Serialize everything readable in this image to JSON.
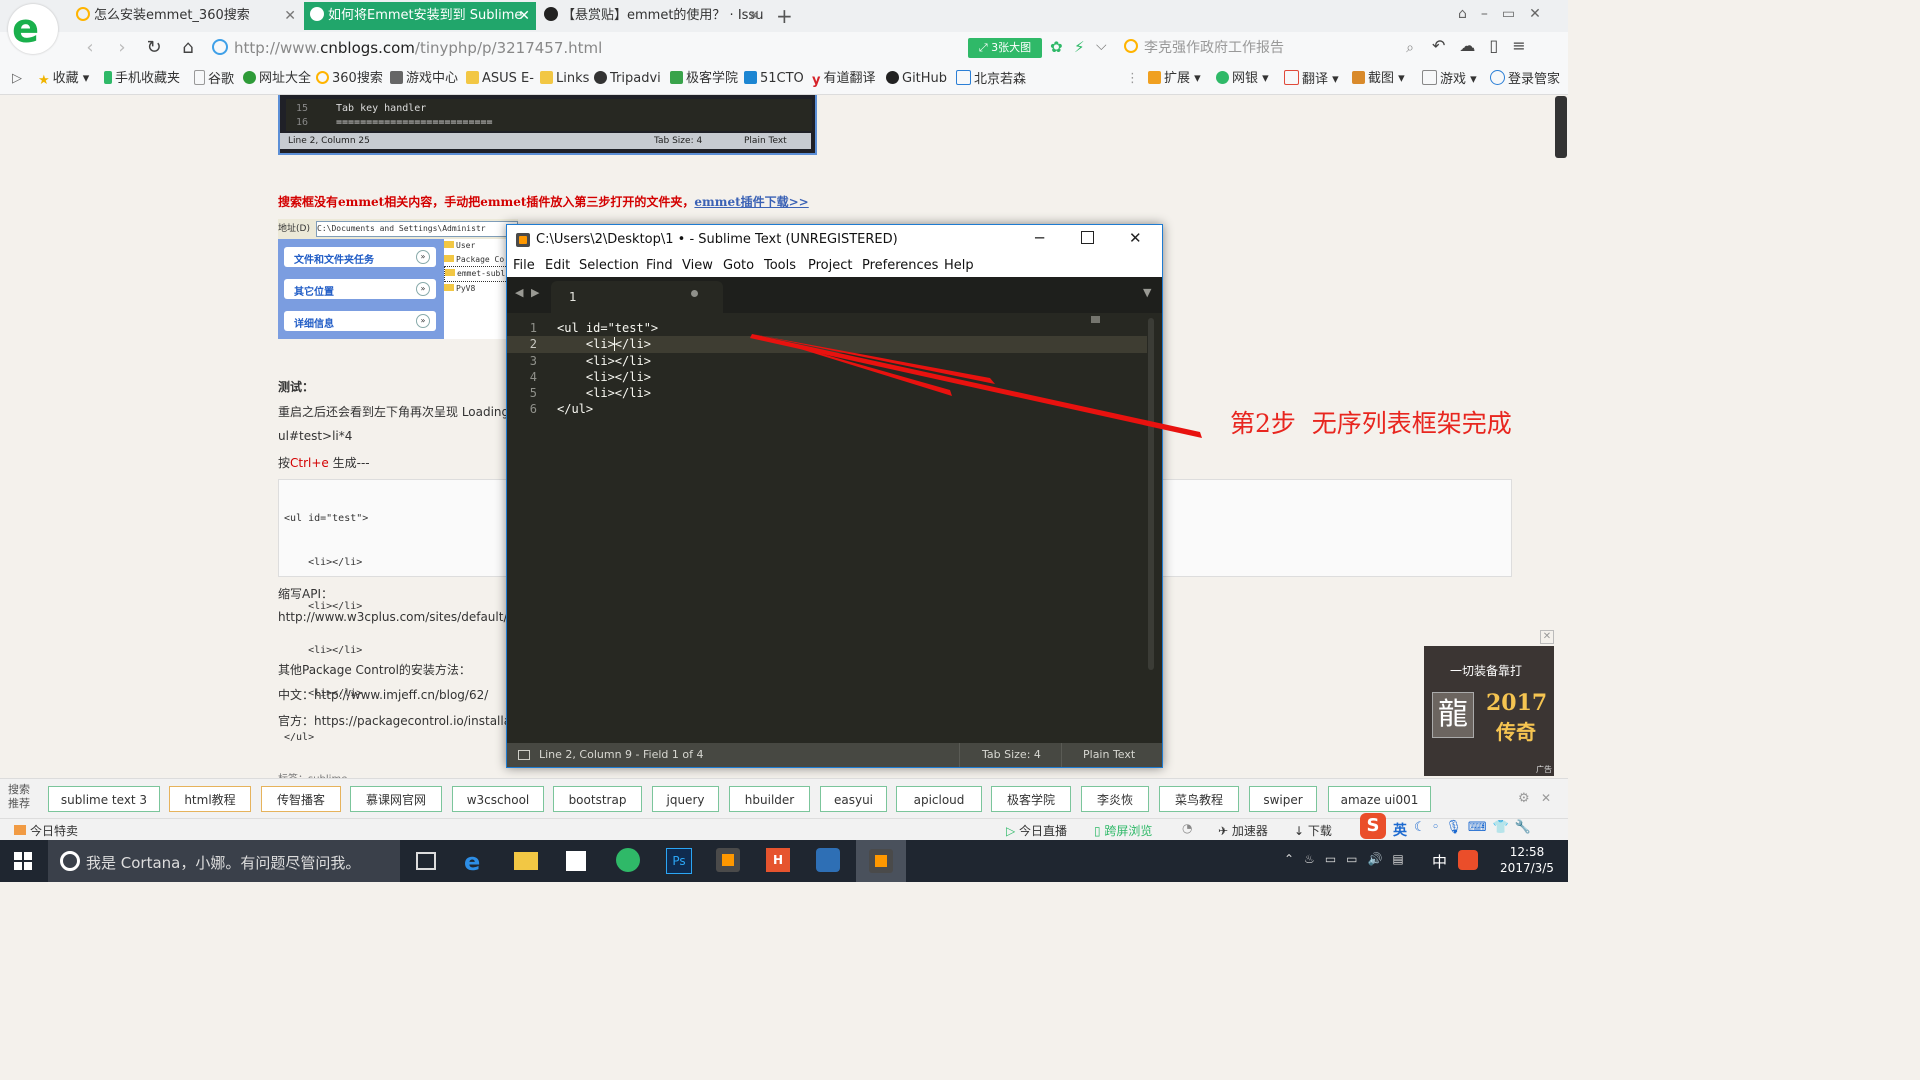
{
  "browser": {
    "tabs": [
      {
        "label": "怎么安装emmet_360搜索",
        "active": false
      },
      {
        "label": "如何将Emmet安装到到 Sublime",
        "active": true
      },
      {
        "label": "【悬赏贴】emmet的使用？ · Issu",
        "active": false
      }
    ],
    "url_prefix": "http://www.",
    "url_host": "cnblogs.com",
    "url_path": "/tinyphp/p/3217457.html",
    "big_pic_label": "3张大图",
    "search_hint": "李克强作政府工作报告",
    "bookmarks": [
      "收藏",
      "手机收藏夹",
      "谷歌",
      "网址大全",
      "360搜索",
      "游戏中心",
      "ASUS E-",
      "Links",
      "Tripadvi",
      "极客学院",
      "51CTO",
      "有道翻译",
      "GitHub",
      "北京若森"
    ],
    "tool_items": [
      "扩展",
      "网银",
      "翻译",
      "截图",
      "游戏",
      "登录管家"
    ]
  },
  "article": {
    "top_code": {
      "line_numbers": [
        "15",
        "16"
      ],
      "lines": [
        "Tab key handler",
        "=========================="
      ],
      "status_left": "Line 2, Column 25",
      "status_tab": "Tab Size: 4",
      "status_syntax": "Plain Text"
    },
    "red_note": "搜索框没有emmet相关内容，手动把emmet插件放入第三步打开的文件夹，",
    "red_link": "emmet插件下载>>",
    "explorer": {
      "address_label": "地址(D)",
      "address_value": "C:\\Documents and Settings\\Administr",
      "tasks": [
        "文件和文件夹任务",
        "其它位置",
        "详细信息"
      ],
      "folders": [
        "User",
        "Package Co",
        "emmet-subl",
        "PyV8"
      ]
    },
    "test_heading": "测试：",
    "test_line1": "重启之后还会看到左下角再次呈现 Loading P",
    "test_line2": "ul#test>li*4",
    "test_line3_pre": "按",
    "test_line3_key": "Ctrl+e",
    "test_line3_post": " 生成---",
    "code_lines": [
      "<ul id=\"test\">",
      "    <li></li>",
      "    <li></li>",
      "    <li></li>",
      "    <li></li>",
      "</ul>"
    ],
    "api_label": "缩写API：",
    "api_url": "http://www.w3cplus.com/sites/default/f",
    "pkg_heading": "其他Package Control的安装方法：",
    "pkg_cn": "中文：http://www.imjeff.cn/blog/62/",
    "pkg_official": "官方：https://packagecontrol.io/installat",
    "tags_label": "标签：sublime"
  },
  "sublime": {
    "title": "C:\\Users\\2\\Desktop\\1 • - Sublime Text (UNREGISTERED)",
    "menu": [
      "File",
      "Edit",
      "Selection",
      "Find",
      "View",
      "Goto",
      "Tools",
      "Project",
      "Preferences",
      "Help"
    ],
    "tab_label": "1",
    "line_numbers": [
      "1",
      "2",
      "3",
      "4",
      "5",
      "6"
    ],
    "code": [
      "<ul id=\"test\">",
      "    <li></li>",
      "    <li></li>",
      "    <li></li>",
      "    <li></li>",
      "</ul>"
    ],
    "status_left": "Line 2, Column 9 - Field 1 of 4",
    "status_tab": "Tab Size: 4",
    "status_syntax": "Plain Text"
  },
  "annotation": "第2步  无序列表框架完成",
  "ad": {
    "line1": "一切装备靠打",
    "year": "2017",
    "word": "传奇",
    "badge": "广告"
  },
  "hotwords": {
    "label1": "搜索",
    "label2": "推荐",
    "items": [
      "sublime text 3",
      "html教程",
      "传智播客",
      "慕课网官网",
      "w3cschool",
      "bootstrap",
      "jquery",
      "hbuilder",
      "easyui",
      "apicloud",
      "极客学院",
      "李炎恢",
      "菜鸟教程",
      "swiper",
      "amaze ui001"
    ]
  },
  "statusbar": {
    "today": "今日特卖",
    "items": [
      "今日直播",
      "跨屏浏览",
      "加速器",
      "下载"
    ],
    "ime": "英"
  },
  "taskbar": {
    "cortana": "我是 Cortana，小娜。有问题尽管问我。",
    "time": "12:58",
    "date": "2017/3/5",
    "lang": "中"
  }
}
